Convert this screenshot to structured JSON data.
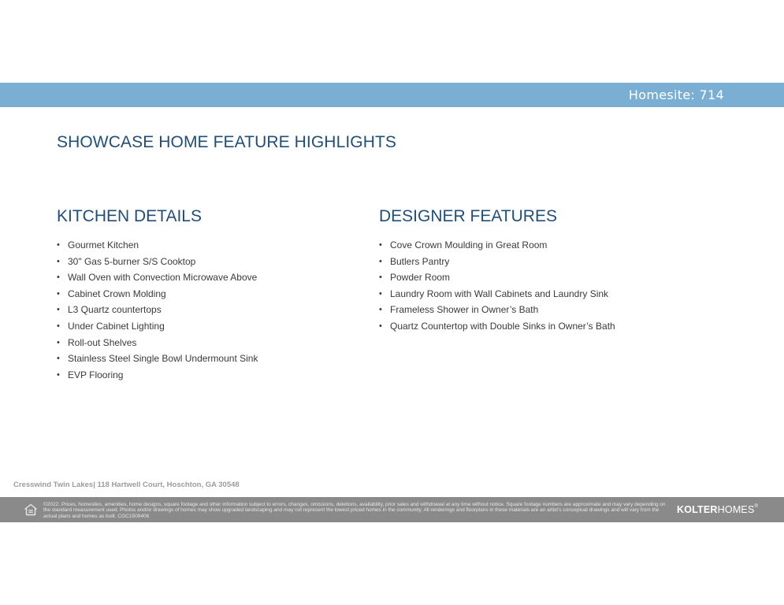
{
  "header": {
    "homesite": "Homesite: 714"
  },
  "page_title": "SHOWCASE HOME FEATURE HIGHLIGHTS",
  "kitchen": {
    "heading": "KITCHEN DETAILS",
    "items": [
      "Gourmet Kitchen",
      "30\" Gas 5-burner S/S Cooktop",
      "Wall Oven with Convection Microwave Above",
      "Cabinet Crown Molding",
      "L3 Quartz countertops",
      "Under Cabinet Lighting",
      "Roll-out Shelves",
      "Stainless Steel Single Bowl Undermount Sink",
      "EVP Flooring"
    ]
  },
  "designer": {
    "heading": "DESIGNER FEATURES",
    "items": [
      "Cove Crown Moulding in Great Room",
      "Butlers Pantry",
      "Powder Room",
      "Laundry Room with Wall Cabinets and Laundry Sink",
      "Frameless Shower in Owner’s Bath",
      "Quartz Countertop with Double Sinks in Owner’s Bath"
    ]
  },
  "address": "Cresswind Twin Lakes| 118 Hartwell Court,  Hoschton, GA 30548",
  "footer": {
    "icon": "equal-housing-icon",
    "disclaimer": "©2022. Prices, homesites, amenities, home designs, square footage and other information subject to errors, changes, omissions, deletions, availability, prior sales and withdrawal at any time without notice. Square footage numbers are approximate and may vary depending on the standard measurement used. Photos and/or drawings of homes may show upgraded landscaping and may not represent the lowest priced homes in the community. All renderings and floorplans in these materials are an artist’s conceptual drawings and will vary from the actual plans and homes as built. CGC1509406",
    "logo_bold": "KOLTER",
    "logo_regular": "HOMES",
    "logo_mark": "®"
  },
  "colors": {
    "band": "#7aaed2",
    "heading": "#1f4e79",
    "footer": "#8a8a8a"
  }
}
